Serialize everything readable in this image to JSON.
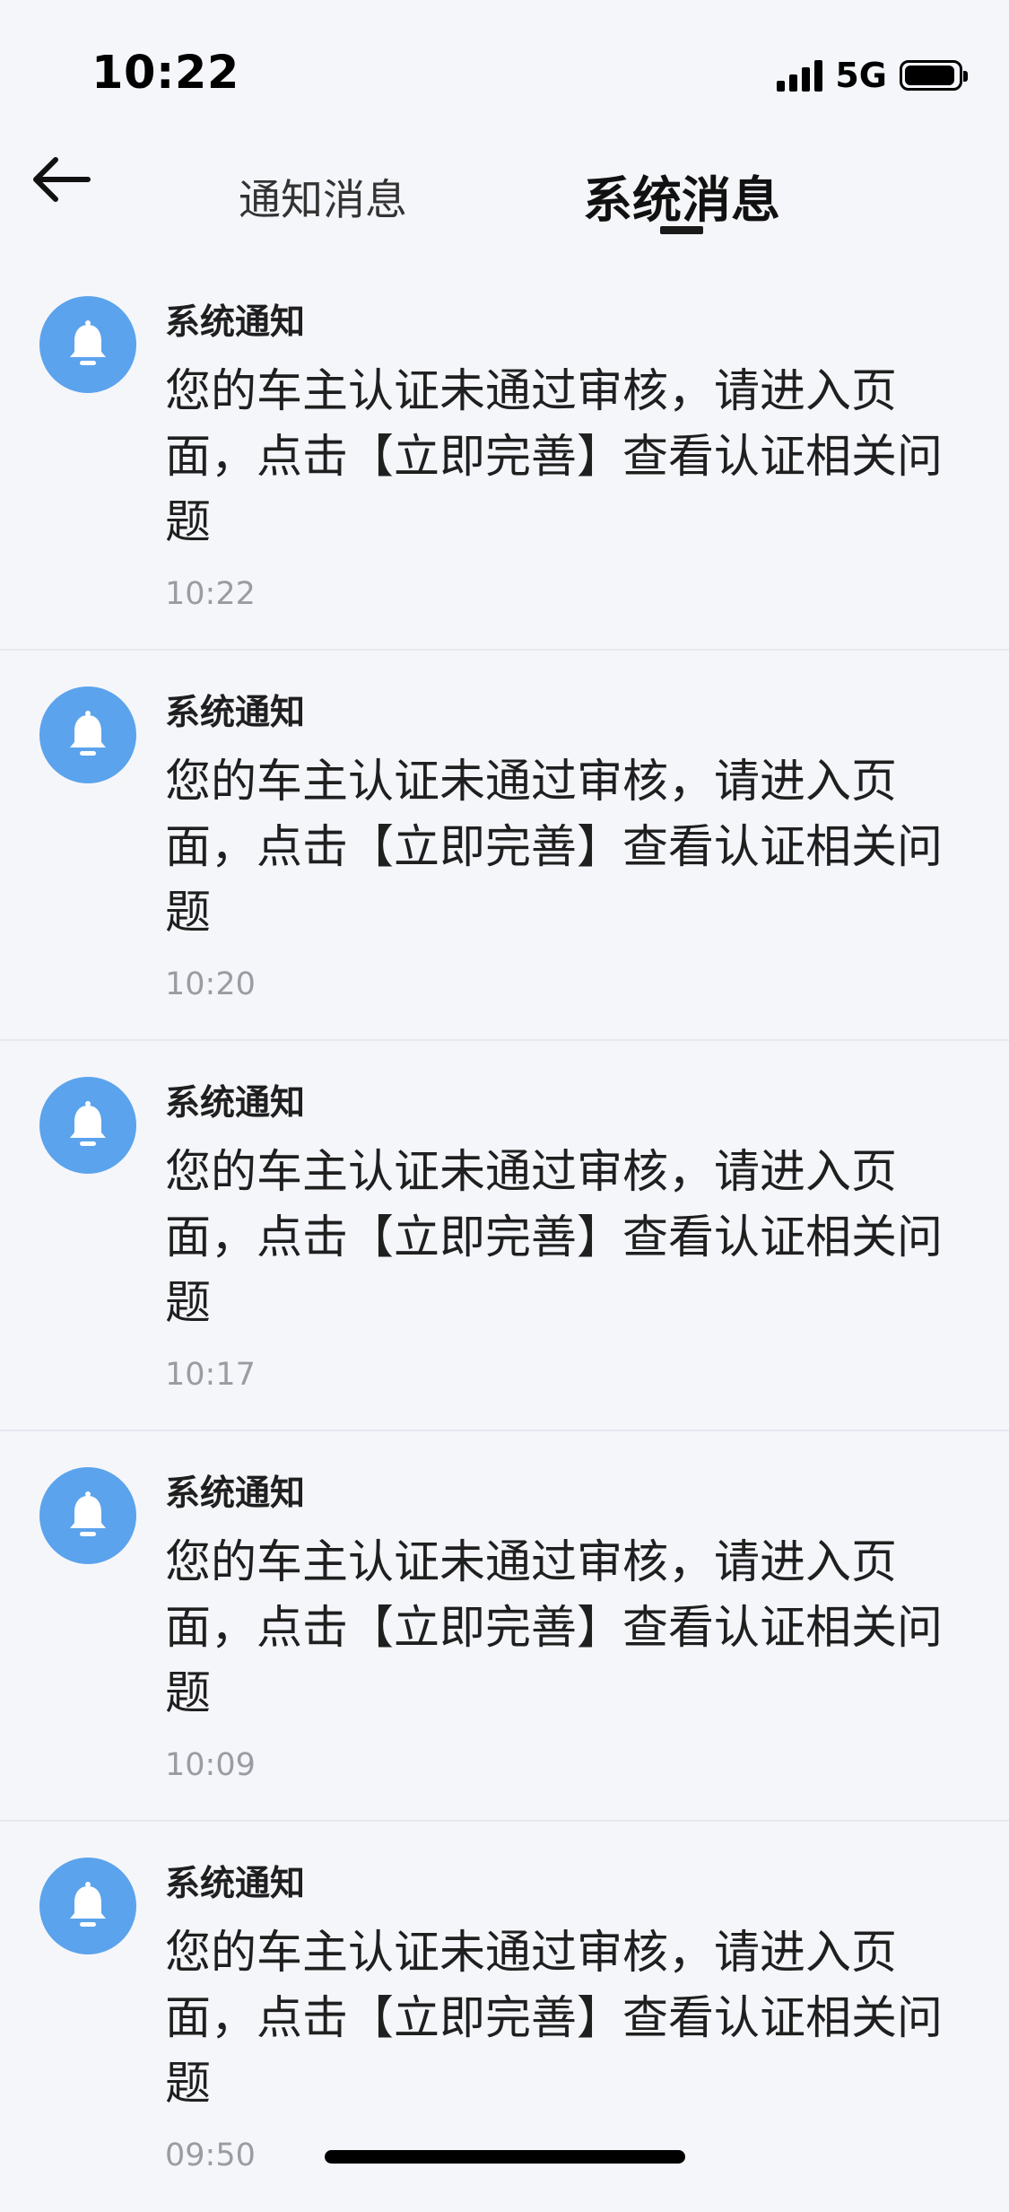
{
  "status_bar": {
    "time": "10:22",
    "network": "5G",
    "icons": [
      "signal-icon",
      "battery-icon"
    ]
  },
  "nav": {
    "back_icon": "arrow-left-icon",
    "tabs": [
      {
        "label": "通知消息",
        "active": false
      },
      {
        "label": "系统消息",
        "active": true
      }
    ]
  },
  "messages": [
    {
      "icon": "bell-icon",
      "title": "系统通知",
      "body": "您的车主认证未通过审核，请进入页面，点击【立即完善】查看认证相关问题",
      "time": "10:22"
    },
    {
      "icon": "bell-icon",
      "title": "系统通知",
      "body": "您的车主认证未通过审核，请进入页面，点击【立即完善】查看认证相关问题",
      "time": "10:20"
    },
    {
      "icon": "bell-icon",
      "title": "系统通知",
      "body": "您的车主认证未通过审核，请进入页面，点击【立即完善】查看认证相关问题",
      "time": "10:17"
    },
    {
      "icon": "bell-icon",
      "title": "系统通知",
      "body": "您的车主认证未通过审核，请进入页面，点击【立即完善】查看认证相关问题",
      "time": "10:09"
    },
    {
      "icon": "bell-icon",
      "title": "系统通知",
      "body": "您的车主认证未通过审核，请进入页面，点击【立即完善】查看认证相关问题",
      "time": "09:50"
    }
  ],
  "colors": {
    "background": "#f5f6fa",
    "avatar": "#5ba3ec",
    "time_text": "#9a9ca3",
    "divider": "#e6e8ee"
  }
}
